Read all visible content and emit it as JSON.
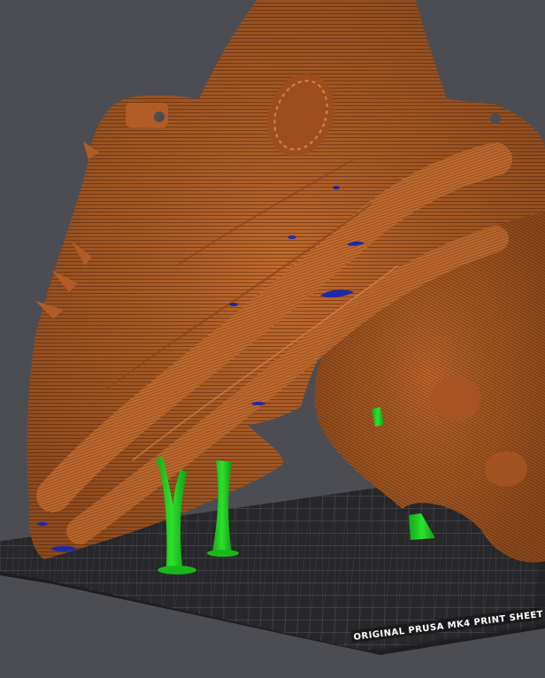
{
  "viewport": {
    "background": "#4c4d52"
  },
  "bed": {
    "label": "ORIGINAL PRUSA MK4 PRINT SHEET",
    "surface_color": "#262629",
    "grid_color": "#5a5a60"
  },
  "model": {
    "color": "#c0692c",
    "shade_color": "#8a4316",
    "highlight_color": "#d9874a",
    "overhang_marker_color": "#1c2aa8"
  },
  "supports": {
    "color": "#1fcc1f",
    "count": 4
  }
}
